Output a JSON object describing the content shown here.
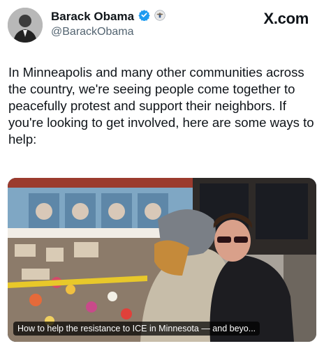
{
  "author": {
    "name": "Barack Obama",
    "handle": "@BarackObama",
    "verified_icon": "verified-badge-icon",
    "affiliation_icon": "presidential-seal-icon"
  },
  "source": "X.com",
  "tweet": {
    "text": "In Minneapolis and many other communities across the country, we're seeing people come together to peacefully protest and support their neighbors. If you're looking to get involved, here are some ways to help:"
  },
  "link_card": {
    "caption": "How to help the resistance to ICE in Minnesota — and beyo...",
    "image": "photo of two people embracing at a memorial with flowers and signs in front of a storefront with portrait posters"
  },
  "colors": {
    "text": "#0f1419",
    "secondary": "#536471",
    "verified": "#1d9bf0"
  }
}
